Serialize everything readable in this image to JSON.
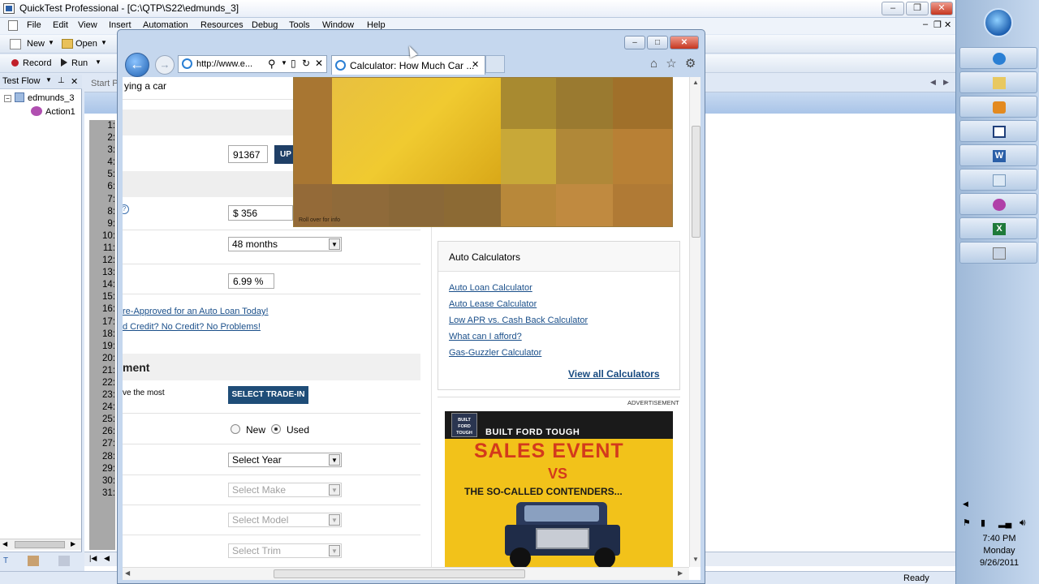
{
  "qtp": {
    "title": "QuickTest Professional - [C:\\QTP\\S22\\edmunds_3]",
    "window_buttons": [
      "–",
      "❐",
      "✕"
    ],
    "menu": [
      "File",
      "Edit",
      "View",
      "Insert",
      "Automation",
      "Resources",
      "Debug",
      "Tools",
      "Window",
      "Help"
    ],
    "toolbar": {
      "new_label": "New",
      "open_label": "Open",
      "record_label": "Record",
      "run_label": "Run"
    },
    "testflow": {
      "title": "Test Flow",
      "root": "edmunds_3",
      "child": "Action1"
    },
    "editor_tab": "Start P",
    "line_numbers": [
      "1:",
      "2:",
      "3:",
      "4:",
      "5:",
      "6:",
      "7:",
      "8:",
      "9:",
      "10:",
      "11:",
      "12:",
      "13:",
      "14:",
      "15:",
      "16:",
      "17:",
      "18:",
      "19:",
      "20:",
      "21:",
      "22:",
      "23:",
      "24:",
      "25:",
      "26:",
      "27:",
      "28:",
      "29:",
      "30:",
      "31:"
    ],
    "status": "Ready"
  },
  "browser": {
    "address": "http://www.e...",
    "tab_title": "Calculator: How Much Car ...",
    "nav_icons": [
      "⌂",
      "☆",
      "⚙"
    ],
    "page": {
      "crumb": "ying a car",
      "zip": "91367",
      "update_btn": "UP",
      "payment": "$ 356",
      "term": "48 months",
      "rate": "6.99",
      "rate_unit": "%",
      "links": [
        "re-Approved for an Auto Loan Today!",
        "d Credit? No Credit? No Problems!"
      ],
      "section_heading": "ment",
      "tradein_text": "ve the most",
      "tradein_btn": "SELECT TRADE-IN",
      "radio_new": "New",
      "radio_used": "Used",
      "selects": [
        "Select Year",
        "Select Make",
        "Select Model",
        "Select Trim"
      ],
      "ad_caption": "Roll over for info",
      "calc_heading": "Auto Calculators",
      "calc_links": [
        "Auto Loan Calculator",
        "Auto Lease Calculator",
        "Low APR vs. Cash Back Calculator",
        "What can I afford?",
        "Gas-Guzzler Calculator"
      ],
      "view_all": "View all Calculators",
      "advertisement": "ADVERTISEMENT",
      "ford": {
        "badge": "BUILT FORD TOUGH",
        "line1": "BUILT FORD TOUGH",
        "line2": "SALES EVENT",
        "line3": "VS",
        "line4": "THE SO-CALLED CONTENDERS..."
      }
    }
  },
  "tray": {
    "time": "7:40 PM",
    "day": "Monday",
    "date": "9/26/2011"
  }
}
